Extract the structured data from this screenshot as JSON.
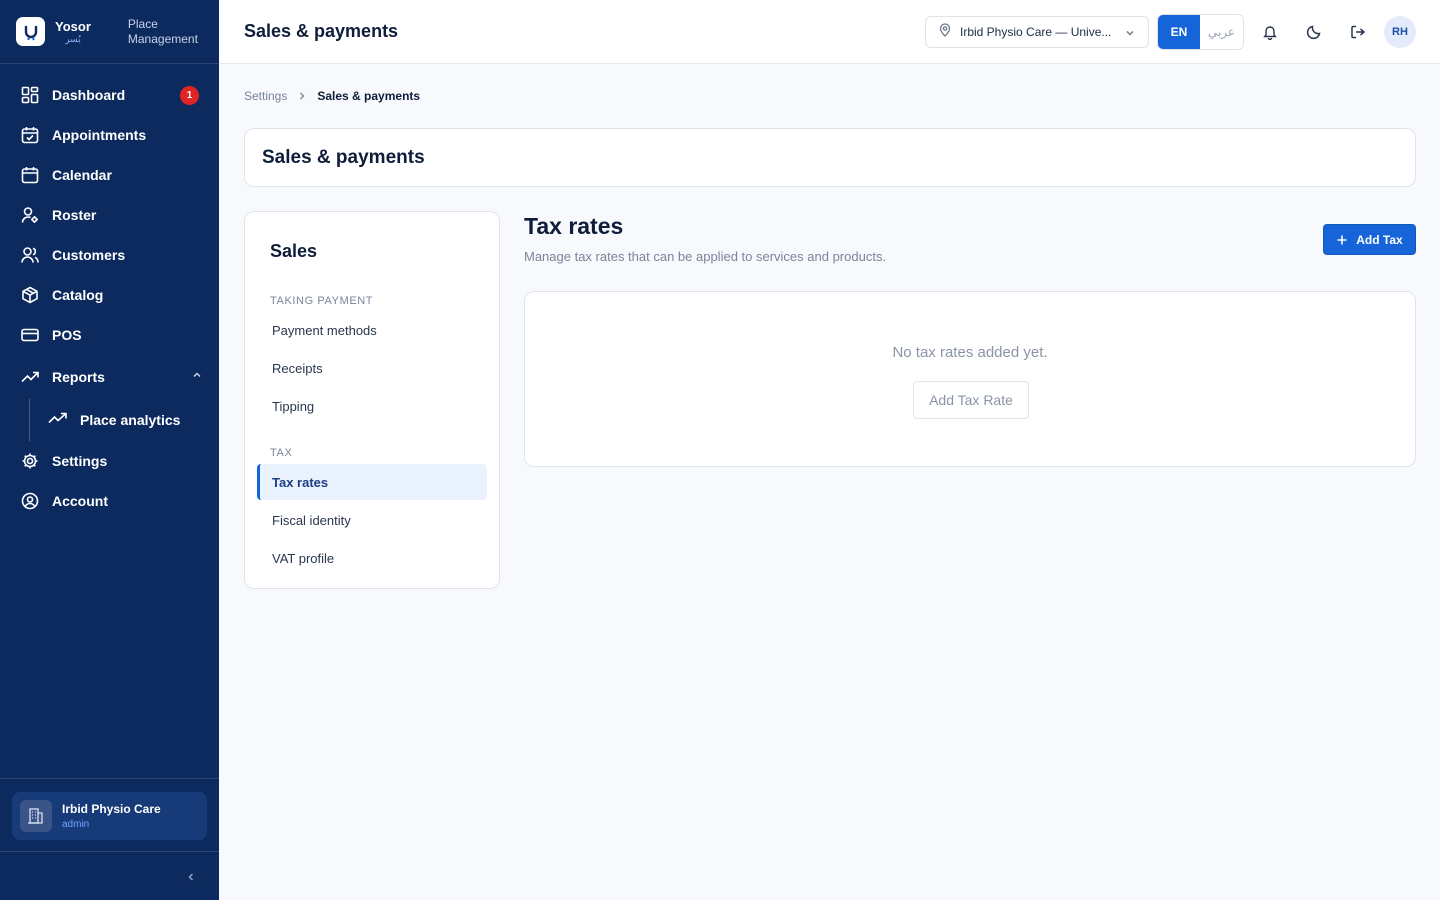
{
  "brand": {
    "name": "Yosor",
    "name_ar": "يُسر",
    "subtitle_line1": "Place",
    "subtitle_line2": "Management"
  },
  "sidebar": {
    "items": [
      {
        "label": "Dashboard",
        "icon": "dashboard-icon",
        "badge": "1"
      },
      {
        "label": "Appointments",
        "icon": "calendar-check-icon"
      },
      {
        "label": "Calendar",
        "icon": "calendar-icon"
      },
      {
        "label": "Roster",
        "icon": "user-cog-icon"
      },
      {
        "label": "Customers",
        "icon": "users-icon"
      },
      {
        "label": "Catalog",
        "icon": "box-icon"
      },
      {
        "label": "POS",
        "icon": "credit-card-icon"
      },
      {
        "label": "Reports",
        "icon": "trending-up-icon",
        "expanded": true
      },
      {
        "label": "Place analytics",
        "icon": "trending-up-icon",
        "sub": true
      },
      {
        "label": "Settings",
        "icon": "gear-icon"
      },
      {
        "label": "Account",
        "icon": "user-circle-icon"
      }
    ],
    "place": {
      "name": "Irbid Physio Care",
      "role": "admin"
    }
  },
  "header": {
    "title": "Sales & payments",
    "location": "Irbid Physio Care — Unive...",
    "lang_en": "EN",
    "lang_ar": "عربي",
    "avatar": "RH"
  },
  "breadcrumb": {
    "parent": "Settings",
    "current": "Sales & payments"
  },
  "page_title": "Sales & payments",
  "settings_nav": {
    "title": "Sales",
    "section_payment": "TAKING PAYMENT",
    "payment_items": [
      "Payment methods",
      "Receipts",
      "Tipping"
    ],
    "section_tax": "TAX",
    "tax_items": [
      "Tax rates",
      "Fiscal identity",
      "VAT profile"
    ],
    "active": "Tax rates"
  },
  "content": {
    "title": "Tax rates",
    "subtitle": "Manage tax rates that can be applied to services and products.",
    "add_button": "Add Tax",
    "empty_message": "No tax rates added yet.",
    "empty_button": "Add Tax Rate"
  },
  "colors": {
    "sidebar": "#0d2a5e",
    "accent": "#1565d8",
    "badge": "#e02424",
    "background": "#f7f9fc"
  }
}
